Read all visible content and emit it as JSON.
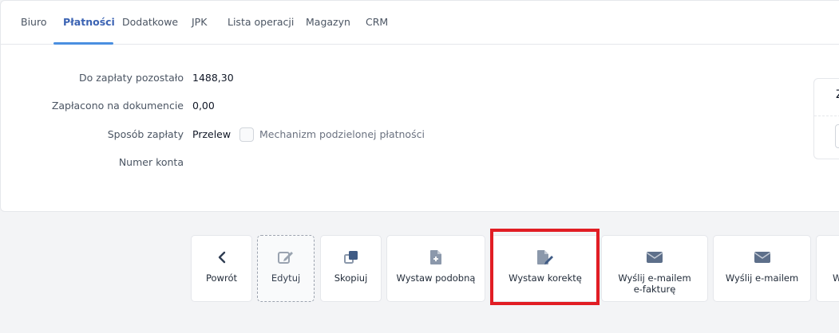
{
  "tabs": [
    "Biuro",
    "Płatności",
    "Dodatkowe",
    "JPK",
    "Lista operacji",
    "Magazyn",
    "CRM"
  ],
  "active_tab": "Płatności",
  "payment": {
    "remaining_label": "Do zapłaty pozostało",
    "remaining_value": "1488,30",
    "paid_label": "Zapłacono na dokumencie",
    "paid_value": "0,00",
    "method_label": "Sposób zapłaty",
    "method_value": "Przelew",
    "split_payment_label": "Mechanizm podzielonej płatności",
    "split_payment_checked": false,
    "account_label": "Numer konta",
    "account_value": ""
  },
  "side_card": {
    "partial_letter": "Z"
  },
  "actions": [
    {
      "label": "Powrót",
      "icon": "chevron-left-icon"
    },
    {
      "label": "Edytuj",
      "icon": "edit-icon"
    },
    {
      "label": "Skopiuj",
      "icon": "copy-icon"
    },
    {
      "label": "Wystaw podobną",
      "icon": "file-plus-icon"
    },
    {
      "label": "Wystaw korektę",
      "icon": "file-edit-icon"
    },
    {
      "label": "Wyślij e-mailem\ne-fakturę",
      "icon": "envelope-icon"
    },
    {
      "label": "Wyślij e-mailem",
      "icon": "envelope-icon"
    },
    {
      "label": "W",
      "icon": ""
    }
  ],
  "colors": {
    "accent": "#3b63b3",
    "tab_underline": "#4a8fe0",
    "icon": "#5d6f8a",
    "highlight": "#e11d24"
  }
}
